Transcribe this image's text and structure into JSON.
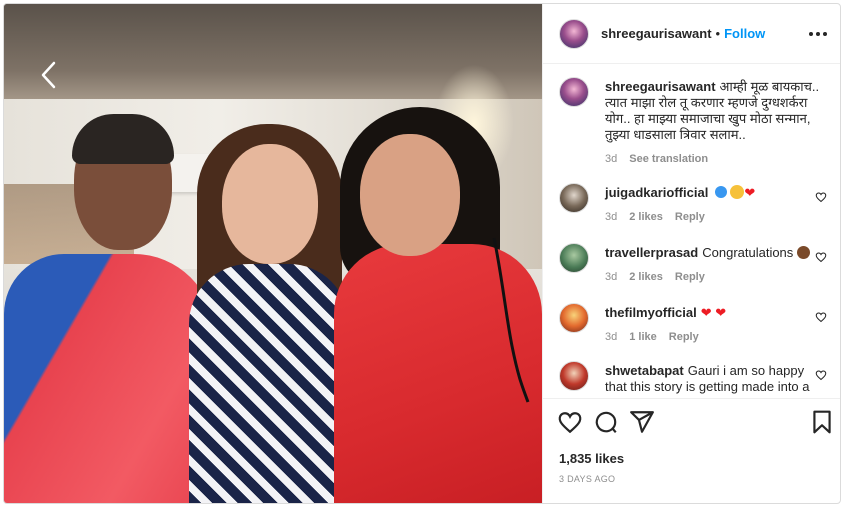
{
  "post": {
    "username": "shreegaurisawant",
    "separator": "•",
    "follow_label": "Follow",
    "caption": "आम्ही मूळ बायकाच.. त्यात माझा रोल तू करणार म्हणजे दुग्धशर्करा योग.. हा माझ्या समाजाचा खुप मोठा सन्मान, तुझ्या धाडसाला त्रिवार सलाम..",
    "caption_time": "3d",
    "see_translation": "See translation",
    "likes": "1,835 likes",
    "posted": "3 DAYS AGO"
  },
  "comments": [
    {
      "user": "juigadkariofficial",
      "text": "",
      "time": "3d",
      "likes": "2 likes",
      "reply": "Reply"
    },
    {
      "user": "travellerprasad",
      "text": "Congratulations",
      "time": "3d",
      "likes": "2 likes",
      "reply": "Reply"
    },
    {
      "user": "thefilmyofficial",
      "text": "",
      "time": "3d",
      "likes": "1 like",
      "reply": "Reply"
    },
    {
      "user": "shwetabapat",
      "text": "Gauri i am so happy that this story is getting made into a",
      "time": "",
      "likes": "",
      "reply": ""
    }
  ],
  "icons": {
    "back": "chevron-left-icon",
    "more": "more-horizontal-icon",
    "like": "heart-icon",
    "comment": "comment-icon",
    "share": "share-icon",
    "save": "bookmark-icon",
    "comment_like": "heart-outline-icon"
  },
  "colors": {
    "accent": "#0095f6",
    "heart": "#ed1c24"
  }
}
